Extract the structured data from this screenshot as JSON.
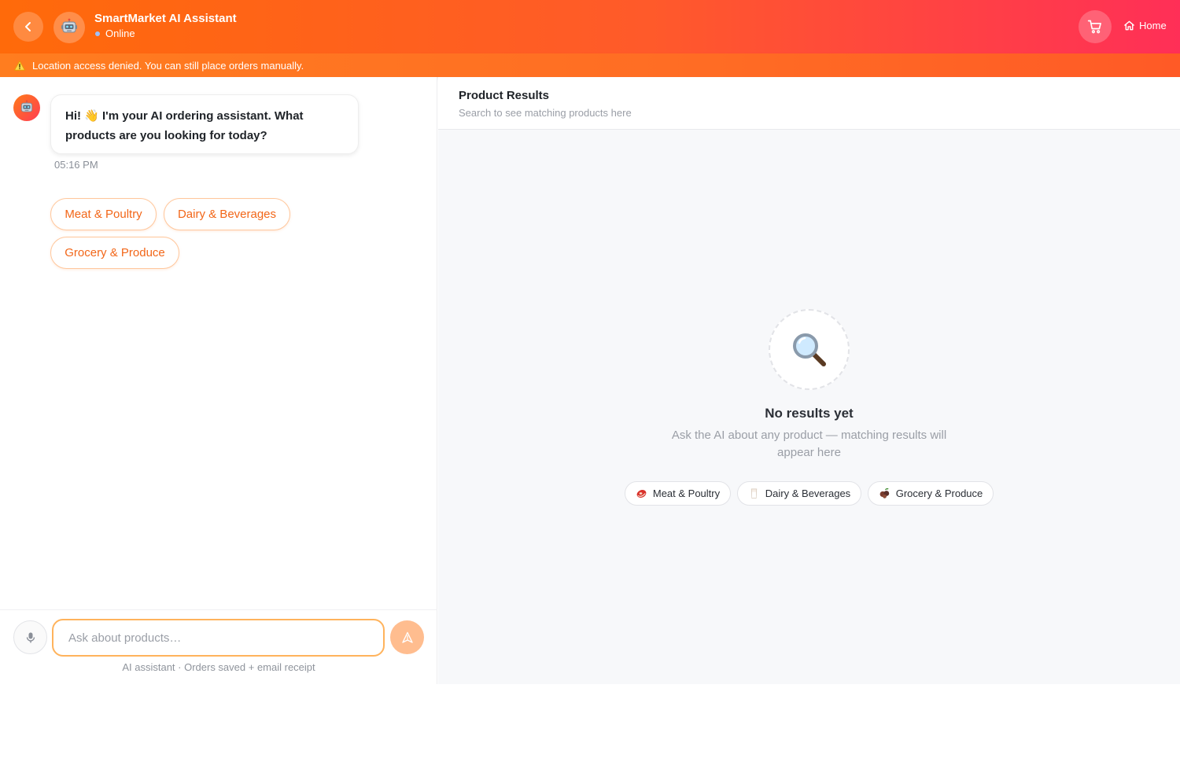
{
  "header": {
    "title": "SmartMarket AI Assistant",
    "status": "Online",
    "home_label": "Home",
    "back_icon": "chevron-left-icon",
    "avatar_icon": "robot-icon",
    "cart_icon": "cart-icon",
    "home_icon": "home-icon"
  },
  "banner": {
    "icon": "warning-icon",
    "text": "Location access denied. You can still place orders manually."
  },
  "chat": {
    "message": {
      "line1": "Hi! 👋 I'm your AI ordering assistant. What",
      "line2": "products are you looking for today?",
      "time": "05:16 PM"
    },
    "suggestions": [
      "Meat & Poultry",
      "Dairy & Beverages",
      "Grocery & Produce"
    ],
    "input_placeholder": "Ask about products…",
    "footer_note": "AI assistant · Orders saved + email receipt"
  },
  "results": {
    "title": "Product Results",
    "subtitle": "Search to see matching products here",
    "empty_icon": "magnifier-icon",
    "empty_title": "No results yet",
    "empty_desc": "Ask the AI about any product — matching results will appear here",
    "categories": [
      {
        "label": "Meat & Poultry",
        "icon": "meat-icon"
      },
      {
        "label": "Dairy & Beverages",
        "icon": "milk-icon"
      },
      {
        "label": "Grocery & Produce",
        "icon": "produce-icon"
      }
    ]
  },
  "colors": {
    "brand_start": "#ff6a0a",
    "brand_end": "#ff2f57",
    "accent_text": "#f26618",
    "input_border": "#ffb35c"
  }
}
